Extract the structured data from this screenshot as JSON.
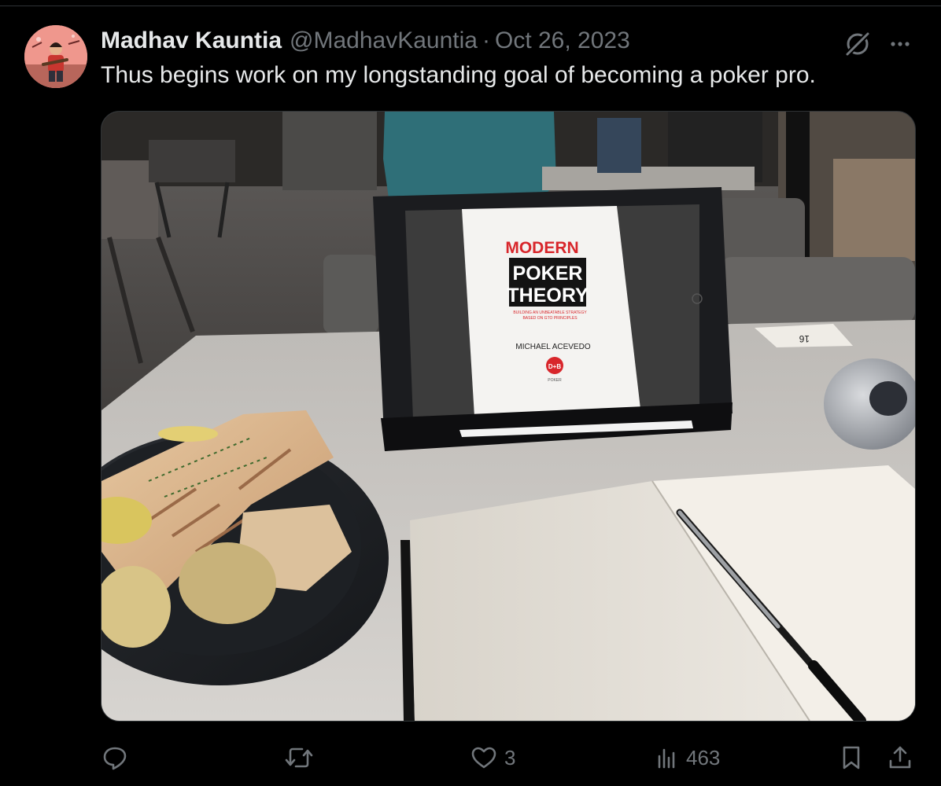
{
  "tweet": {
    "author_name": "Madhav Kauntia",
    "handle": "@MadhavKauntia",
    "separator": "·",
    "date": "Oct 26, 2023",
    "text": "Thus begins work on my longstanding goal of becoming a poker pro.",
    "media_alt": "iPad showing Modern Poker Theory book cover on a cafe table with a wrap, chips and an open notebook"
  },
  "media_text": {
    "book_title_1": "MODERN",
    "book_title_2": "POKER",
    "book_title_3": "THEORY",
    "book_subtitle_1": "BUILDING AN UNBEATABLE STRATEGY",
    "book_subtitle_2": "BASED ON GTO PRINCIPLES",
    "book_author": "MICHAEL ACEVEDO",
    "publisher_logo": "D+B",
    "publisher_sub": "POKER",
    "table_number": "16"
  },
  "actions": {
    "reply_count": "",
    "retweet_count": "",
    "like_count": "3",
    "views_count": "463"
  },
  "colors": {
    "background": "#000000",
    "primary_text": "#e7e9ea",
    "secondary_text": "#71767b",
    "border": "#2f3336",
    "book_red": "#d8262b"
  },
  "icons": [
    "grok-icon",
    "more-icon",
    "reply-icon",
    "retweet-icon",
    "like-icon",
    "views-icon",
    "bookmark-icon",
    "share-icon"
  ]
}
